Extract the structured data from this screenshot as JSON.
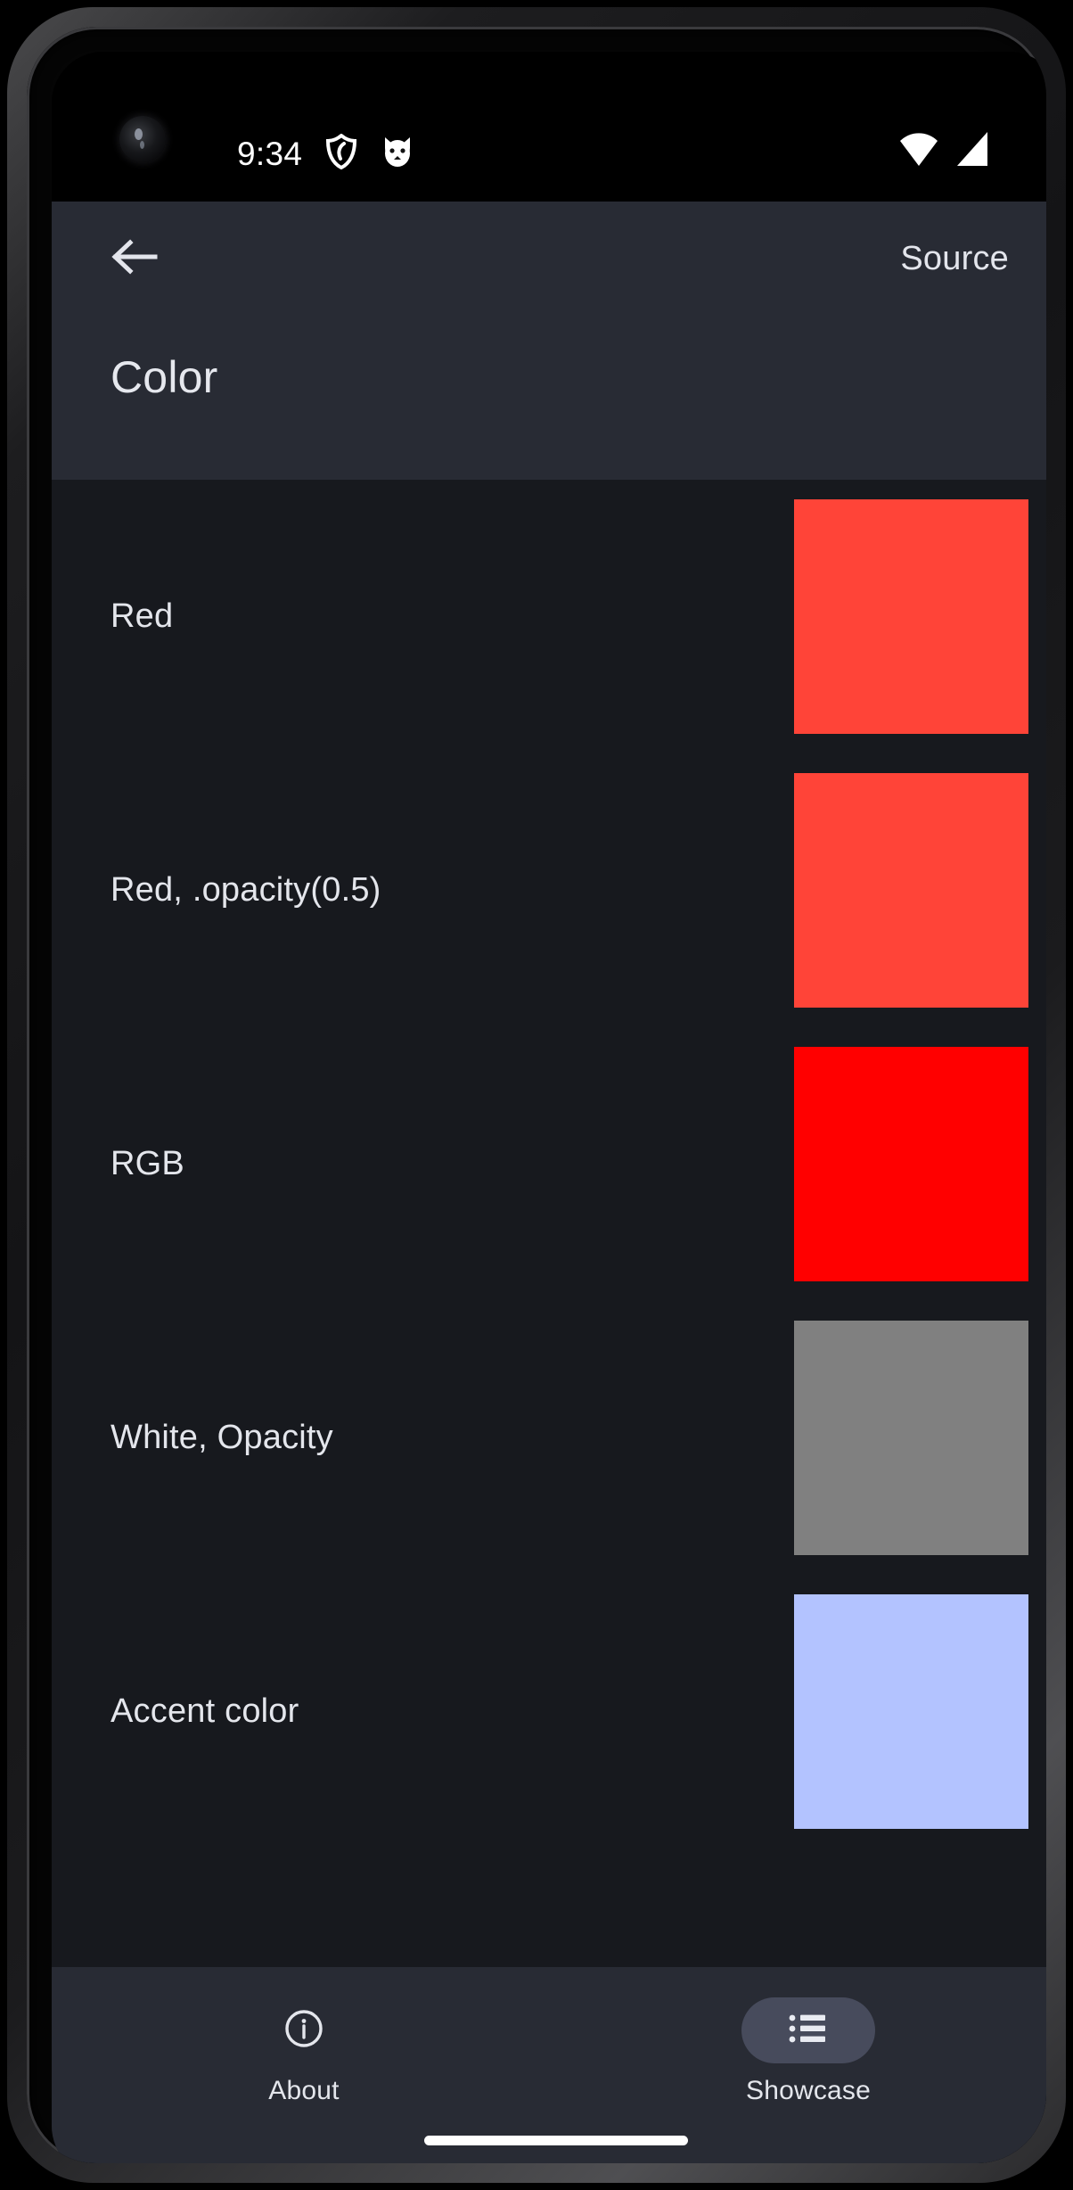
{
  "status_bar": {
    "time": "9:34",
    "left_icons": [
      "shield-icon",
      "cat-face-icon"
    ],
    "right_icons": [
      "wifi-icon",
      "cellular-signal-icon"
    ]
  },
  "app_bar": {
    "back_icon": "back-arrow-icon",
    "source_label": "Source",
    "title": "Color",
    "background": "#282B34"
  },
  "list": {
    "background": "#17191E",
    "rows": [
      {
        "label": "Red",
        "swatch_color": "#FF4438"
      },
      {
        "label": "Red, .opacity(0.5)",
        "swatch_color": "#FF4438"
      },
      {
        "label": "RGB",
        "swatch_color": "#FF0000"
      },
      {
        "label": "White, Opacity",
        "swatch_color": "#808080"
      },
      {
        "label": "Accent color",
        "swatch_color": "#B3C3FF"
      }
    ]
  },
  "bottom_nav": {
    "background": "#282B34",
    "selected_pill_color": "#474B5C",
    "items": [
      {
        "label": "About",
        "icon": "info-circle-icon",
        "selected": false
      },
      {
        "label": "Showcase",
        "icon": "list-bullet-icon",
        "selected": true
      }
    ]
  }
}
